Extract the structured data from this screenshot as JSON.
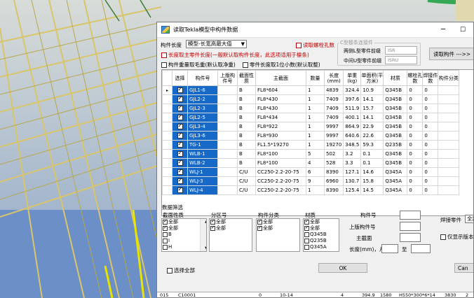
{
  "window": {
    "title": "读取Tekla模型中构件数据",
    "min_glyph": "─",
    "max_glyph": "☐"
  },
  "options": {
    "component_length_label": "构件长度",
    "component_length_value": "模型-长宽高最大值",
    "read_bolt_holes_label": "读取螺栓孔数",
    "read_bolt_holes_checked": false,
    "main_part_length_label": "长度取主零件长度(一般默认取构件长度，此选项适用于檩条)",
    "main_part_length_checked": false,
    "component_weight_label": "构件重量取毛重(默认取净重)",
    "component_weight_checked": false,
    "part_length_decimal_label": "零件长度取1位小数(默认取整)",
    "part_length_decimal_checked": false
  },
  "c_purlin": {
    "legend": "C型檩条连接件",
    "two_sided_label": "两侧L型零件前缀",
    "two_sided_value": "ISR",
    "middle_label": "中间U型零件前缀",
    "middle_value": "ISRU"
  },
  "read_button": "读取构件 --->>",
  "grid": {
    "columns": [
      "选择",
      "构件号",
      "上版构件号",
      "截面性质",
      "主截面",
      "数量",
      "长度(mm)",
      "单重(kg)",
      "单面积(平方米)",
      "材质",
      "螺栓孔数",
      "焊接件数",
      "构件分类"
    ],
    "rows": [
      {
        "mark": "▸",
        "selected": true,
        "part": "GJL1-6",
        "prev": "",
        "section_type": "B",
        "main_section": "FL8*604",
        "qty": "1",
        "length": "4839",
        "weight": "324.4",
        "area": "10.9",
        "material": "Q345B",
        "bolt": "0",
        "weld": "0",
        "cat": ""
      },
      {
        "mark": "",
        "selected": true,
        "part": "GJL2-2",
        "prev": "",
        "section_type": "B",
        "main_section": "FL8*430",
        "qty": "1",
        "length": "7409",
        "weight": "397.6",
        "area": "14.1",
        "material": "Q345B",
        "bolt": "0",
        "weld": "0",
        "cat": ""
      },
      {
        "mark": "",
        "selected": true,
        "part": "GJL2-3",
        "prev": "",
        "section_type": "B",
        "main_section": "FL8*430",
        "qty": "1",
        "length": "7409",
        "weight": "511.9",
        "area": "15.7",
        "material": "Q345B",
        "bolt": "0",
        "weld": "0",
        "cat": ""
      },
      {
        "mark": "",
        "selected": true,
        "part": "GJL2-5",
        "prev": "",
        "section_type": "B",
        "main_section": "FL8*434",
        "qty": "1",
        "length": "7409",
        "weight": "400.1",
        "area": "14.1",
        "material": "Q345B",
        "bolt": "0",
        "weld": "0",
        "cat": ""
      },
      {
        "mark": "",
        "selected": true,
        "part": "GJL3-4",
        "prev": "",
        "section_type": "B",
        "main_section": "FL8*922",
        "qty": "1",
        "length": "9997",
        "weight": "864.9",
        "area": "22.9",
        "material": "Q345B",
        "bolt": "0",
        "weld": "0",
        "cat": ""
      },
      {
        "mark": "",
        "selected": true,
        "part": "GJL3-6",
        "prev": "",
        "section_type": "B",
        "main_section": "FL8*930",
        "qty": "1",
        "length": "9997",
        "weight": "640.6",
        "area": "22.6",
        "material": "Q345B",
        "bolt": "0",
        "weld": "0",
        "cat": ""
      },
      {
        "mark": "",
        "selected": true,
        "part": "TG-1",
        "prev": "",
        "section_type": "B",
        "main_section": "FL1.5*19270",
        "qty": "1",
        "length": "19270",
        "weight": "348.5",
        "area": "59.3",
        "material": "Q235B",
        "bolt": "0",
        "weld": "0",
        "cat": ""
      },
      {
        "mark": "",
        "selected": true,
        "part": "WLB-1",
        "prev": "",
        "section_type": "B",
        "main_section": "FL8*100",
        "qty": "5",
        "length": "502",
        "weight": "3.2",
        "area": "0.1",
        "material": "Q345B",
        "bolt": "0",
        "weld": "0",
        "cat": ""
      },
      {
        "mark": "",
        "selected": true,
        "part": "WLB-2",
        "prev": "",
        "section_type": "B",
        "main_section": "FL8*100",
        "qty": "4",
        "length": "528",
        "weight": "3.3",
        "area": "0.1",
        "material": "Q345B",
        "bolt": "0",
        "weld": "0",
        "cat": ""
      },
      {
        "mark": "",
        "selected": true,
        "part": "WLJ-1",
        "prev": "",
        "section_type": "C/U",
        "main_section": "CC250-2.2-20-75",
        "qty": "6",
        "length": "8390",
        "weight": "127.1",
        "area": "14.6",
        "material": "Q345A",
        "bolt": "0",
        "weld": "0",
        "cat": ""
      },
      {
        "mark": "",
        "selected": true,
        "part": "WLJ-3",
        "prev": "",
        "section_type": "C/U",
        "main_section": "CC250-2.2-20-75",
        "qty": "9",
        "length": "6960",
        "weight": "130.7",
        "area": "15.8",
        "material": "Q345A",
        "bolt": "0",
        "weld": "0",
        "cat": ""
      },
      {
        "mark": "",
        "selected": true,
        "part": "WLJ-4",
        "prev": "",
        "section_type": "C/U",
        "main_section": "CC250-2.2-20-75",
        "qty": "1",
        "length": "8390",
        "weight": "125.4",
        "area": "14.5",
        "material": "Q345A",
        "bolt": "0",
        "weld": "0",
        "cat": ""
      }
    ]
  },
  "filter": {
    "title": "数据筛选",
    "section_type_label": "截面性质",
    "section_type_items": [
      {
        "label": "全部",
        "checked": true
      },
      {
        "label": "全部",
        "checked": true
      },
      {
        "label": "B",
        "checked": false
      },
      {
        "label": "I",
        "checked": false
      },
      {
        "label": "H",
        "checked": false
      }
    ],
    "zone_label": "分区号",
    "zone_items": [
      {
        "label": "全部",
        "checked": true
      },
      {
        "label": "全部",
        "checked": true
      }
    ],
    "category_label": "构件分类",
    "category_items": [
      {
        "label": "全部",
        "checked": true
      },
      {
        "label": "全部",
        "checked": true
      }
    ],
    "material_label": "材质",
    "material_items": [
      {
        "label": "全部",
        "checked": true
      },
      {
        "label": "全部",
        "checked": true
      },
      {
        "label": "Q345B",
        "checked": false
      },
      {
        "label": "Q235B",
        "checked": false
      },
      {
        "label": "Q345A",
        "checked": false
      }
    ],
    "part_no_label": "构件号",
    "prev_part_no_label": "上版构件号",
    "main_section_label": "主截面",
    "length_label": "长度(mm)，从",
    "to_label": "至",
    "weld_part_label": "焊接零件",
    "weld_part_value": "全部",
    "only_prev_label": "仅显示版本",
    "select_all_label": "选择全部",
    "ok_button": "OK",
    "cancel_button": "Can"
  },
  "bottom_strip": [
    "015",
    "C10001",
    "0",
    "10-14",
    "4",
    "394.9",
    "1580",
    "H550*300*6*14",
    "3830",
    "2"
  ]
}
